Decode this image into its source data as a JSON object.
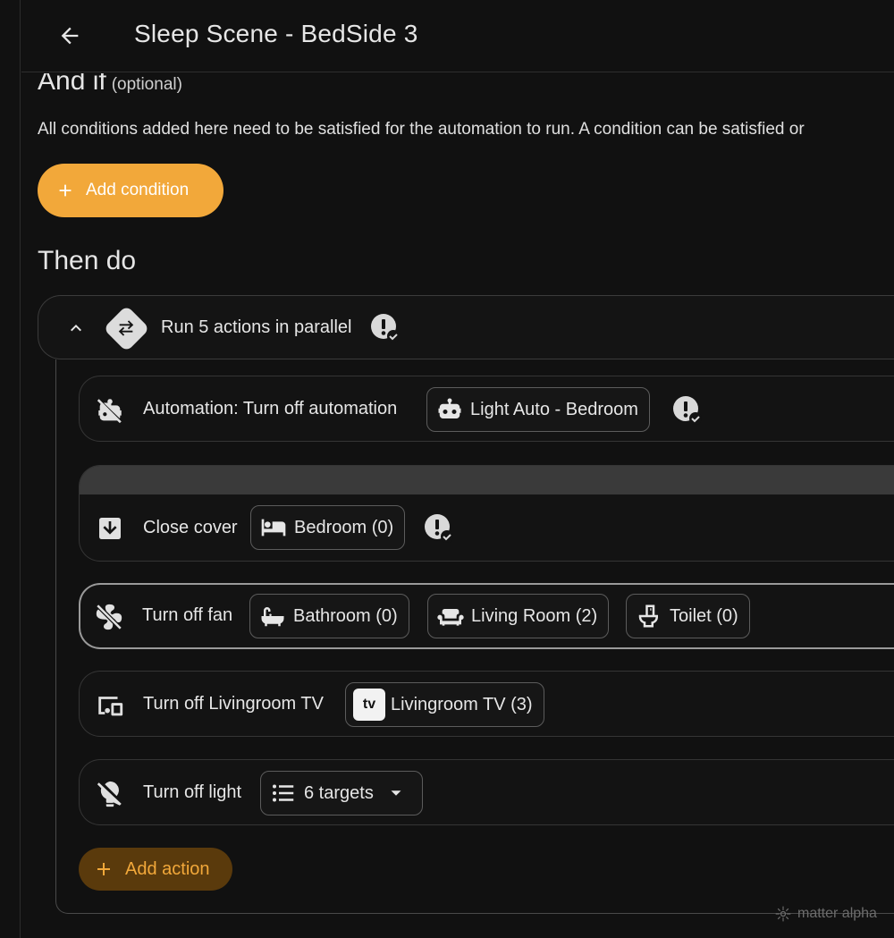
{
  "header": {
    "title": "Sleep Scene - BedSide 3"
  },
  "conditions": {
    "title": "And if",
    "optional": "(optional)",
    "description": "All conditions added here need to be satisfied for the automation to run. A condition can be satisfied or",
    "add_label": "Add condition"
  },
  "actions": {
    "title": "Then do",
    "parallel_label": "Run 5 actions in parallel",
    "add_label": "Add action",
    "rows": [
      {
        "label": "Automation: Turn off automation",
        "icon": "robot-off-icon",
        "chips": [
          {
            "label": "Light Auto - Bedroom",
            "icon": "robot-icon"
          }
        ]
      },
      {
        "label": "Close cover",
        "icon": "arrow-down-box-icon",
        "chips": [
          {
            "label": "Bedroom (0)",
            "icon": "bed-icon"
          }
        ]
      },
      {
        "label": "Turn off fan",
        "icon": "fan-off-icon",
        "chips": [
          {
            "label": "Bathroom (0)",
            "icon": "bathtub-icon"
          },
          {
            "label": "Living Room (2)",
            "icon": "sofa-icon"
          },
          {
            "label": "Toilet (0)",
            "icon": "toilet-icon"
          }
        ]
      },
      {
        "label": "Turn off Livingroom TV",
        "icon": "devices-icon",
        "chips": [
          {
            "label": "Livingroom TV (3)",
            "icon": "apple-tv-icon",
            "badge": "tv"
          }
        ]
      },
      {
        "label": "Turn off light",
        "icon": "lightbulb-off-icon",
        "chips": [
          {
            "label": "6 targets",
            "icon": "list-icon"
          }
        ]
      }
    ]
  },
  "watermark": "matter alpha",
  "colors": {
    "accent": "#f2a83a",
    "background": "#111111"
  }
}
